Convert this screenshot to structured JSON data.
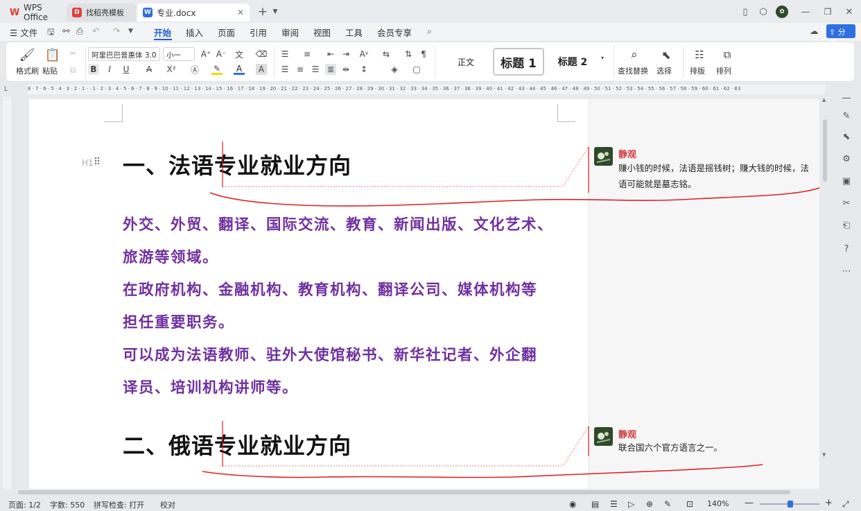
{
  "tabs": {
    "wps": "WPS Office",
    "templates": "找稻壳模板",
    "document": "专业.docx",
    "new_tab": "+"
  },
  "menu": {
    "file": "文件",
    "items": [
      "开始",
      "插入",
      "页面",
      "引用",
      "审阅",
      "视图",
      "工具",
      "会员专享"
    ],
    "active": "开始",
    "share": "分享"
  },
  "ribbon": {
    "format_painter": "格式刷",
    "paste": "粘贴",
    "font_name": "阿里巴巴普惠体 3.0",
    "font_size": "小一",
    "bold": "B",
    "italic": "I",
    "underline": "U",
    "styles": [
      "正文",
      "标题 1",
      "标题 2"
    ],
    "find_replace": "查找替换",
    "select": "选择",
    "layout": "排版",
    "arrange": "排列"
  },
  "document": {
    "heading1": "一、法语专业就业方向",
    "para1_line1": "外交、外贸、翻译、国际交流、教育、新闻出版、文化艺术、",
    "para1_line2": "旅游等领域。",
    "para2_line1": "在政府机构、金融机构、教育机构、翻译公司、媒体机构等",
    "para2_line2": "担任重要职务。",
    "para3_line1": "可以成为法语教师、驻外大使馆秘书、新华社记者、外企翻",
    "para3_line2": "译员、培训机构讲师等。",
    "heading2": "二、俄语专业就业方向",
    "heading_marker": "H1"
  },
  "comments": [
    {
      "author": "静观",
      "text_line1": "赚小钱的时候，法语是摇钱树；赚大钱的时候，法",
      "text_line2": "语可能就是墓志铭。"
    },
    {
      "author": "静观",
      "text_line1": "联合国六个官方语言之一。",
      "text_line2": ""
    }
  ],
  "ruler_ticks": "8 · 7 · 6 · 5 · 4 · 3 · 2 · 1 · · 1 · 2 · 3 · 4 · 5 · 6 · 7 · 8 · 9 · 10 · 11 · 12 · 13 · 14 · 15 · 16 · 17 · 18 · 19 · 20 · 21 · 22 · 23 · 24 · 25 · 26 · 27 · 28 · 29 · 30 · 31 · 32 · 33 · 34 · 35 · 36 · 37 · 38 · 39 · 40 · 41 · 42 · 43 · 44 · 45 · 46 · 47 · 48 · 49 · 50 · 51 · 52 · 53 · 54 · 55 · 56 · 57 · 58 · 59 · 60 · 61 · 62 · 63",
  "status": {
    "page": "页面: 1/2",
    "words": "字数: 550",
    "spell": "拼写检查: 打开",
    "proof": "校对",
    "zoom": "140%"
  },
  "colors": {
    "accent": "#1b5fd6",
    "body_text": "#7030a0",
    "comment_author": "#d13c3c",
    "annotation_line": "#e02020"
  }
}
